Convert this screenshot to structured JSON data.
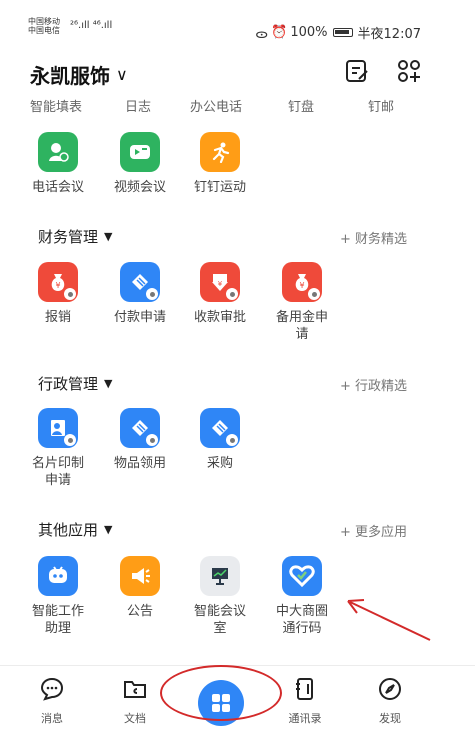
{
  "status_bar": {
    "carrier1": "中国移动",
    "carrier2": "中国电信",
    "signal_text": "²⁶.ıll ⁴⁶.ıll",
    "battery": "100%",
    "time": "半夜12:07"
  },
  "header": {
    "title": "永凯服饰",
    "chevron": "∨"
  },
  "cut_row": [
    "智能填表",
    "日志",
    "办公电话",
    "钉盘",
    "钉邮"
  ],
  "section_top": {
    "apps": [
      {
        "label": "电话会议",
        "icon": "phone-meeting-icon",
        "color": "#2eb360"
      },
      {
        "label": "视频会议",
        "icon": "video-meeting-icon",
        "color": "#2eb360"
      },
      {
        "label": "钉钉运动",
        "icon": "running-icon",
        "color": "#ff9d16"
      }
    ]
  },
  "sections": [
    {
      "title": "财务管理",
      "link": "+ 财务精选",
      "apps": [
        {
          "label": "报销",
          "icon": "money-bag-icon"
        },
        {
          "label": "付款申请",
          "icon": "payment-icon"
        },
        {
          "label": "收款审批",
          "icon": "receipt-icon"
        },
        {
          "label": "备用金申\n请",
          "icon": "money-bag-icon"
        }
      ]
    },
    {
      "title": "行政管理",
      "link": "+ 行政精选",
      "apps": [
        {
          "label": "名片印制\n申请",
          "icon": "card-print-icon"
        },
        {
          "label": "物品领用",
          "icon": "supplies-icon"
        },
        {
          "label": "采购",
          "icon": "purchase-icon"
        }
      ]
    },
    {
      "title": "其他应用",
      "link": "+ 更多应用",
      "apps": [
        {
          "label": "智能工作\n助理",
          "icon": "robot-icon"
        },
        {
          "label": "公告",
          "icon": "megaphone-icon"
        },
        {
          "label": "智能会议\n室",
          "icon": "meeting-room-icon"
        },
        {
          "label": "中大商圈\n通行码",
          "icon": "heart-shield-icon"
        }
      ]
    }
  ],
  "tabs": [
    {
      "label": "消息",
      "icon": "chat-icon"
    },
    {
      "label": "文档",
      "icon": "folder-icon"
    },
    {
      "label": "",
      "icon": "grid-icon"
    },
    {
      "label": "通讯录",
      "icon": "contacts-icon"
    },
    {
      "label": "发现",
      "icon": "compass-icon"
    }
  ],
  "colors": {
    "green": "#2eb360",
    "orange": "#ff9d16",
    "red": "#ef4a3a",
    "blue": "#2f86f6",
    "annotation": "#d32a2a"
  }
}
